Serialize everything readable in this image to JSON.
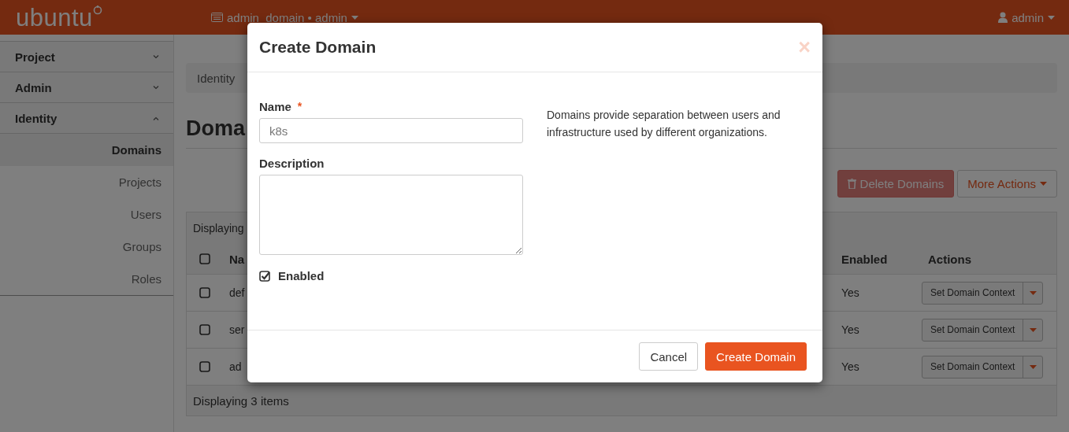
{
  "topbar": {
    "logo": "ubuntu",
    "context": "admin_domain • admin",
    "user": "admin"
  },
  "sidebar": {
    "sections": [
      {
        "label": "Project",
        "expanded": false
      },
      {
        "label": "Admin",
        "expanded": false
      },
      {
        "label": "Identity",
        "expanded": true
      }
    ],
    "items": [
      {
        "label": "Domains",
        "selected": true
      },
      {
        "label": "Projects",
        "selected": false
      },
      {
        "label": "Users",
        "selected": false
      },
      {
        "label": "Groups",
        "selected": false
      },
      {
        "label": "Roles",
        "selected": false
      }
    ]
  },
  "breadcrumb": "Identity",
  "page_title": "Doma",
  "toolbar": {
    "delete_button": "Delete Domains",
    "more_button": "More Actions"
  },
  "table": {
    "caption": "Displaying",
    "all_checked": false,
    "columns": [
      "Na",
      "Enabled",
      "Actions"
    ],
    "rows": [
      {
        "name": "def",
        "enabled": "Yes",
        "action": "Set Domain Context",
        "checked": false
      },
      {
        "name": "ser",
        "enabled": "Yes",
        "action": "Set Domain Context",
        "checked": false
      },
      {
        "name": "ad",
        "enabled": "Yes",
        "action": "Set Domain Context",
        "checked": false
      }
    ],
    "footer": "Displaying 3 items"
  },
  "dialog": {
    "title": "Create Domain",
    "close": "×",
    "required_symbol": "*",
    "fields": [
      {
        "label": "Name",
        "required": true,
        "kind": "text",
        "value": "k8s"
      },
      {
        "label": "Description",
        "required": false,
        "kind": "textarea"
      }
    ],
    "enabled": {
      "label": "Enabled",
      "checked": true
    },
    "help": "Domains provide separation between users and infrastructure used by different organizations.",
    "buttons": [
      {
        "label": "Cancel",
        "kind": "secondary"
      },
      {
        "label": "Create Domain",
        "kind": "primary"
      }
    ]
  }
}
